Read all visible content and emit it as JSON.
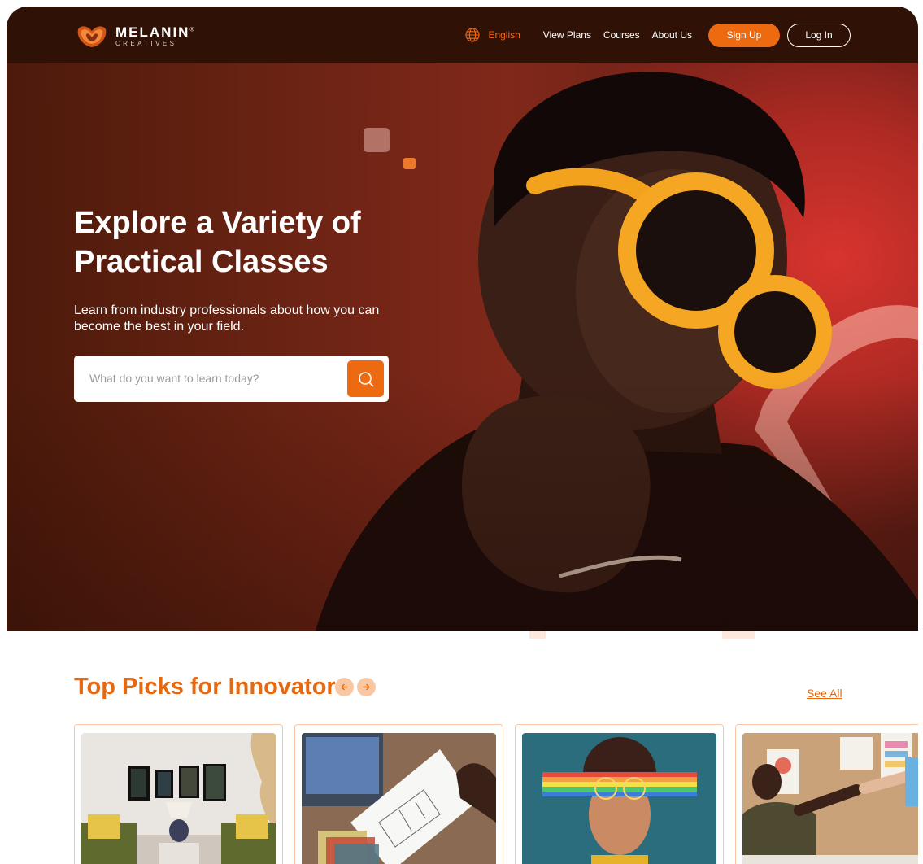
{
  "header": {
    "logo": {
      "name": "MELANIN",
      "sub": "CREATIVES",
      "registered": "®"
    },
    "language": "English",
    "nav": [
      "View Plans",
      "Courses",
      "About Us"
    ],
    "signup_label": "Sign Up",
    "login_label": "Log In"
  },
  "hero": {
    "title": "Explore a Variety of Practical Classes",
    "subtitle": "Learn from industry professionals about how you can become the best in your field.",
    "search": {
      "placeholder": "What do you want to learn today?"
    }
  },
  "top_picks": {
    "title": "Top Picks for Innovators",
    "see_all_label": "See All",
    "cards": [
      {
        "image": "interior-living-room-photo"
      },
      {
        "image": "architecture-floor-plan-photo"
      },
      {
        "image": "rainbow-glasses-portrait-photo"
      },
      {
        "image": "design-team-fist-bump-photo"
      }
    ]
  },
  "colors": {
    "accent": "#ee6a10",
    "header_bg": "#2f1205",
    "hero_red": "#d8342e",
    "section_title": "#e6680f"
  }
}
